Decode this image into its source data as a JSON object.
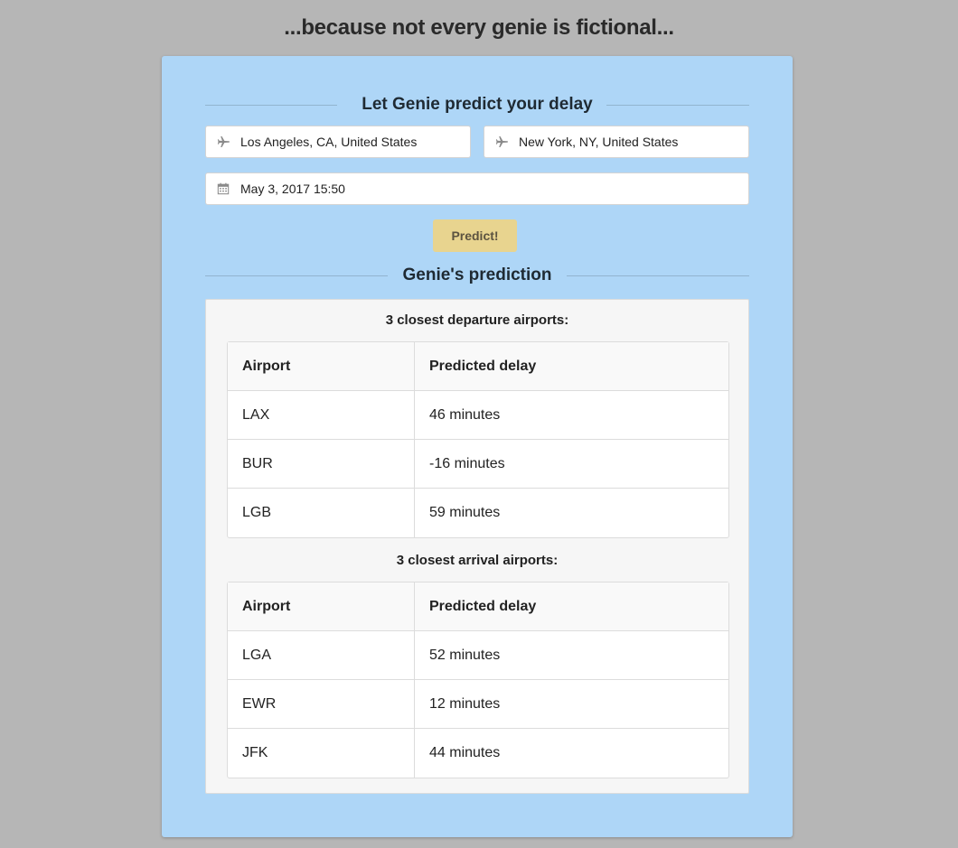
{
  "tagline": "...because not every genie is fictional...",
  "form": {
    "title": "Let Genie predict your delay",
    "origin": {
      "value": "Los Angeles, CA, United States",
      "icon": "plane-icon"
    },
    "destination": {
      "value": "New York, NY, United States",
      "icon": "plane-icon"
    },
    "datetime": {
      "value": "May 3, 2017 15:50",
      "icon": "calendar-icon"
    },
    "predict_label": "Predict!"
  },
  "prediction": {
    "title": "Genie's prediction",
    "departure": {
      "title": "3 closest departure airports:",
      "headers": [
        "Airport",
        "Predicted delay"
      ],
      "rows": [
        [
          "LAX",
          "46 minutes"
        ],
        [
          "BUR",
          "-16 minutes"
        ],
        [
          "LGB",
          "59 minutes"
        ]
      ]
    },
    "arrival": {
      "title": "3 closest arrival airports:",
      "headers": [
        "Airport",
        "Predicted delay"
      ],
      "rows": [
        [
          "LGA",
          "52 minutes"
        ],
        [
          "EWR",
          "12 minutes"
        ],
        [
          "JFK",
          "44 minutes"
        ]
      ]
    }
  },
  "colors": {
    "background": "#b6b6b6",
    "panel": "#aed6f7",
    "button": "#e8d48f"
  }
}
